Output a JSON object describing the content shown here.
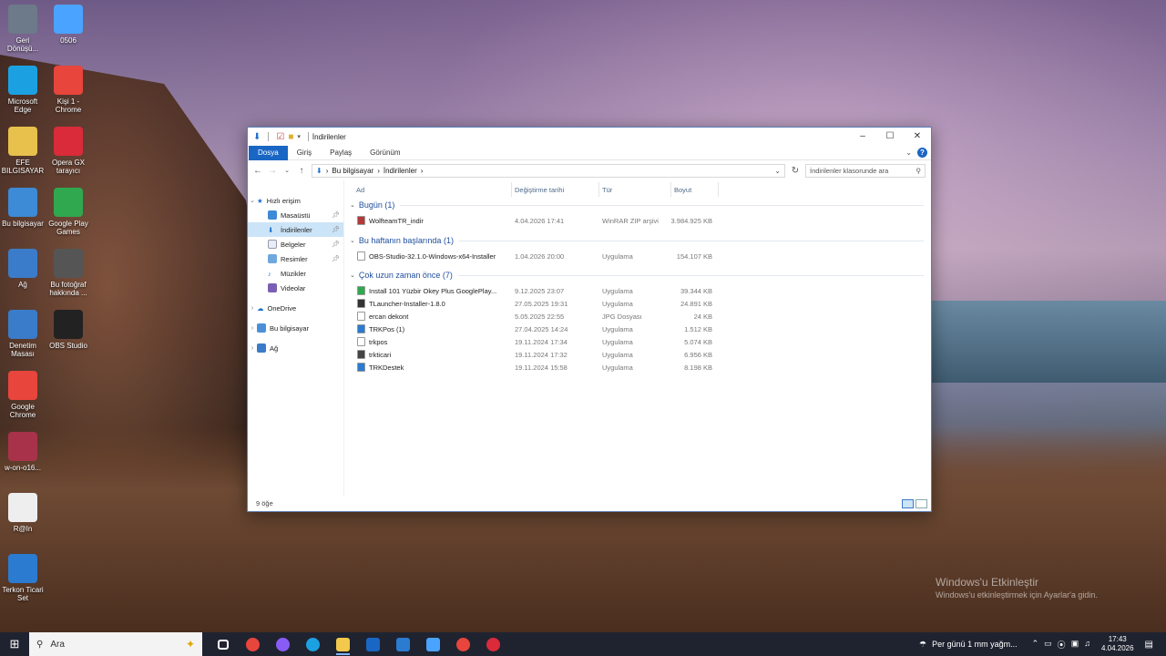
{
  "desktop": {
    "icons": [
      {
        "label": "Geri Dönüşü...",
        "icon": "recycle-bin-icon"
      },
      {
        "label": "0506",
        "icon": "shortcut-icon"
      },
      {
        "label": "Microsoft Edge",
        "icon": "edge-icon"
      },
      {
        "label": "Kişi 1 - Chrome",
        "icon": "chrome-icon"
      },
      {
        "label": "EFE BILGISAYAR",
        "icon": "folder-icon"
      },
      {
        "label": "Opera GX tarayıcı",
        "icon": "opera-gx-icon"
      },
      {
        "label": "Bu bilgisayar",
        "icon": "computer-icon"
      },
      {
        "label": "Google Play Games",
        "icon": "google-play-games-icon"
      },
      {
        "label": "Ağ",
        "icon": "network-icon"
      },
      {
        "label": "Bu fotoğraf hakkında ...",
        "icon": "info-icon"
      },
      {
        "label": "Denetim Masası",
        "icon": "control-panel-icon"
      },
      {
        "label": "OBS Studio",
        "icon": "obs-icon"
      },
      {
        "label": "Google Chrome",
        "icon": "chrome-icon"
      },
      {
        "label": "w-on-o16...",
        "icon": "winrar-icon"
      },
      {
        "label": "R@In",
        "icon": "text-file-icon"
      },
      {
        "label": "Terkon Ticari Set",
        "icon": "terkon-icon"
      }
    ],
    "watermark": {
      "title": "Windows'u Etkinleştir",
      "subtitle": "Windows'u etkinleştirmek için Ayarlar'a gidin."
    }
  },
  "explorer": {
    "title": "İndirilenler",
    "ribbon_tabs": [
      "Dosya",
      "Giriş",
      "Paylaş",
      "Görünüm"
    ],
    "breadcrumb": [
      "Bu bilgisayar",
      "İndirilenler"
    ],
    "search_placeholder": "İndirilenler klasorunde ara",
    "nav": {
      "quick_access": "Hızlı erişim",
      "items": [
        "Masaüstü",
        "İndirilenler",
        "Belgeler",
        "Resimler",
        "Müzikler",
        "Videolar"
      ],
      "onedrive": "OneDrive",
      "this_pc": "Bu bilgisayar",
      "network": "Ağ"
    },
    "columns": [
      "Ad",
      "Değiştirme tarihi",
      "Tür",
      "Boyut"
    ],
    "groups": [
      {
        "title": "Bugün (1)",
        "files": [
          {
            "name": "WolfteamTR_indir",
            "date": "4.04.2026 17:41",
            "type": "WinRAR ZIP arşivi",
            "size": "3.984.925 KB",
            "icon": "winrar-zip-icon",
            "color": "#b33a3a"
          }
        ]
      },
      {
        "title": "Bu haftanın başlarında (1)",
        "files": [
          {
            "name": "OBS-Studio-32.1.0-Windows-x64-Installer",
            "date": "1.04.2026 20:00",
            "type": "Uygulama",
            "size": "154.107 KB",
            "icon": "installer-icon",
            "color": "#ffffff"
          }
        ]
      },
      {
        "title": "Çok uzun zaman önce (7)",
        "files": [
          {
            "name": "Install 101 Yüzbir Okey Plus GooglePlay...",
            "date": "9.12.2025 23:07",
            "type": "Uygulama",
            "size": "39.344 KB",
            "icon": "google-play-icon",
            "color": "#2fa84f"
          },
          {
            "name": "TLauncher-Installer-1.8.0",
            "date": "27.05.2025 19:31",
            "type": "Uygulama",
            "size": "24.891 KB",
            "icon": "tlauncher-icon",
            "color": "#333333"
          },
          {
            "name": "ercan dekont",
            "date": "5.05.2025 22:55",
            "type": "JPG Dosyası",
            "size": "24 KB",
            "icon": "image-file-icon",
            "color": "#ffffff"
          },
          {
            "name": "TRKPos (1)",
            "date": "27.04.2025 14:24",
            "type": "Uygulama",
            "size": "1.512 KB",
            "icon": "trkpos-icon",
            "color": "#2b7bd1"
          },
          {
            "name": "trkpos",
            "date": "19.11.2024 17:34",
            "type": "Uygulama",
            "size": "5.074 KB",
            "icon": "blank-file-icon",
            "color": "#ffffff"
          },
          {
            "name": "trkticari",
            "date": "19.11.2024 17:32",
            "type": "Uygulama",
            "size": "6.956 KB",
            "icon": "trkticari-icon",
            "color": "#444444"
          },
          {
            "name": "TRKDestek",
            "date": "19.11.2024 15:58",
            "type": "Uygulama",
            "size": "8.198 KB",
            "icon": "trkdestek-icon",
            "color": "#2b7bd1"
          }
        ]
      }
    ],
    "status": "9 öğe"
  },
  "taskbar": {
    "search_placeholder": "Ara",
    "weather": "Per günü 1 mm yağm...",
    "time": "17:43",
    "date": "4.04.2026",
    "apps": [
      {
        "name": "task-view",
        "color": "#ffffff"
      },
      {
        "name": "chrome",
        "color": "#e8453c"
      },
      {
        "name": "copilot",
        "color": "#8a5cf6"
      },
      {
        "name": "edge",
        "color": "#1ba1e2"
      },
      {
        "name": "file-explorer",
        "color": "#f2c94c"
      },
      {
        "name": "outlook",
        "color": "#1a66c4"
      },
      {
        "name": "terkon",
        "color": "#2b7bd1"
      },
      {
        "name": "store",
        "color": "#4aa3ff"
      },
      {
        "name": "chrome-profile",
        "color": "#e8453c"
      },
      {
        "name": "opera-gx",
        "color": "#d92b3a"
      }
    ]
  }
}
